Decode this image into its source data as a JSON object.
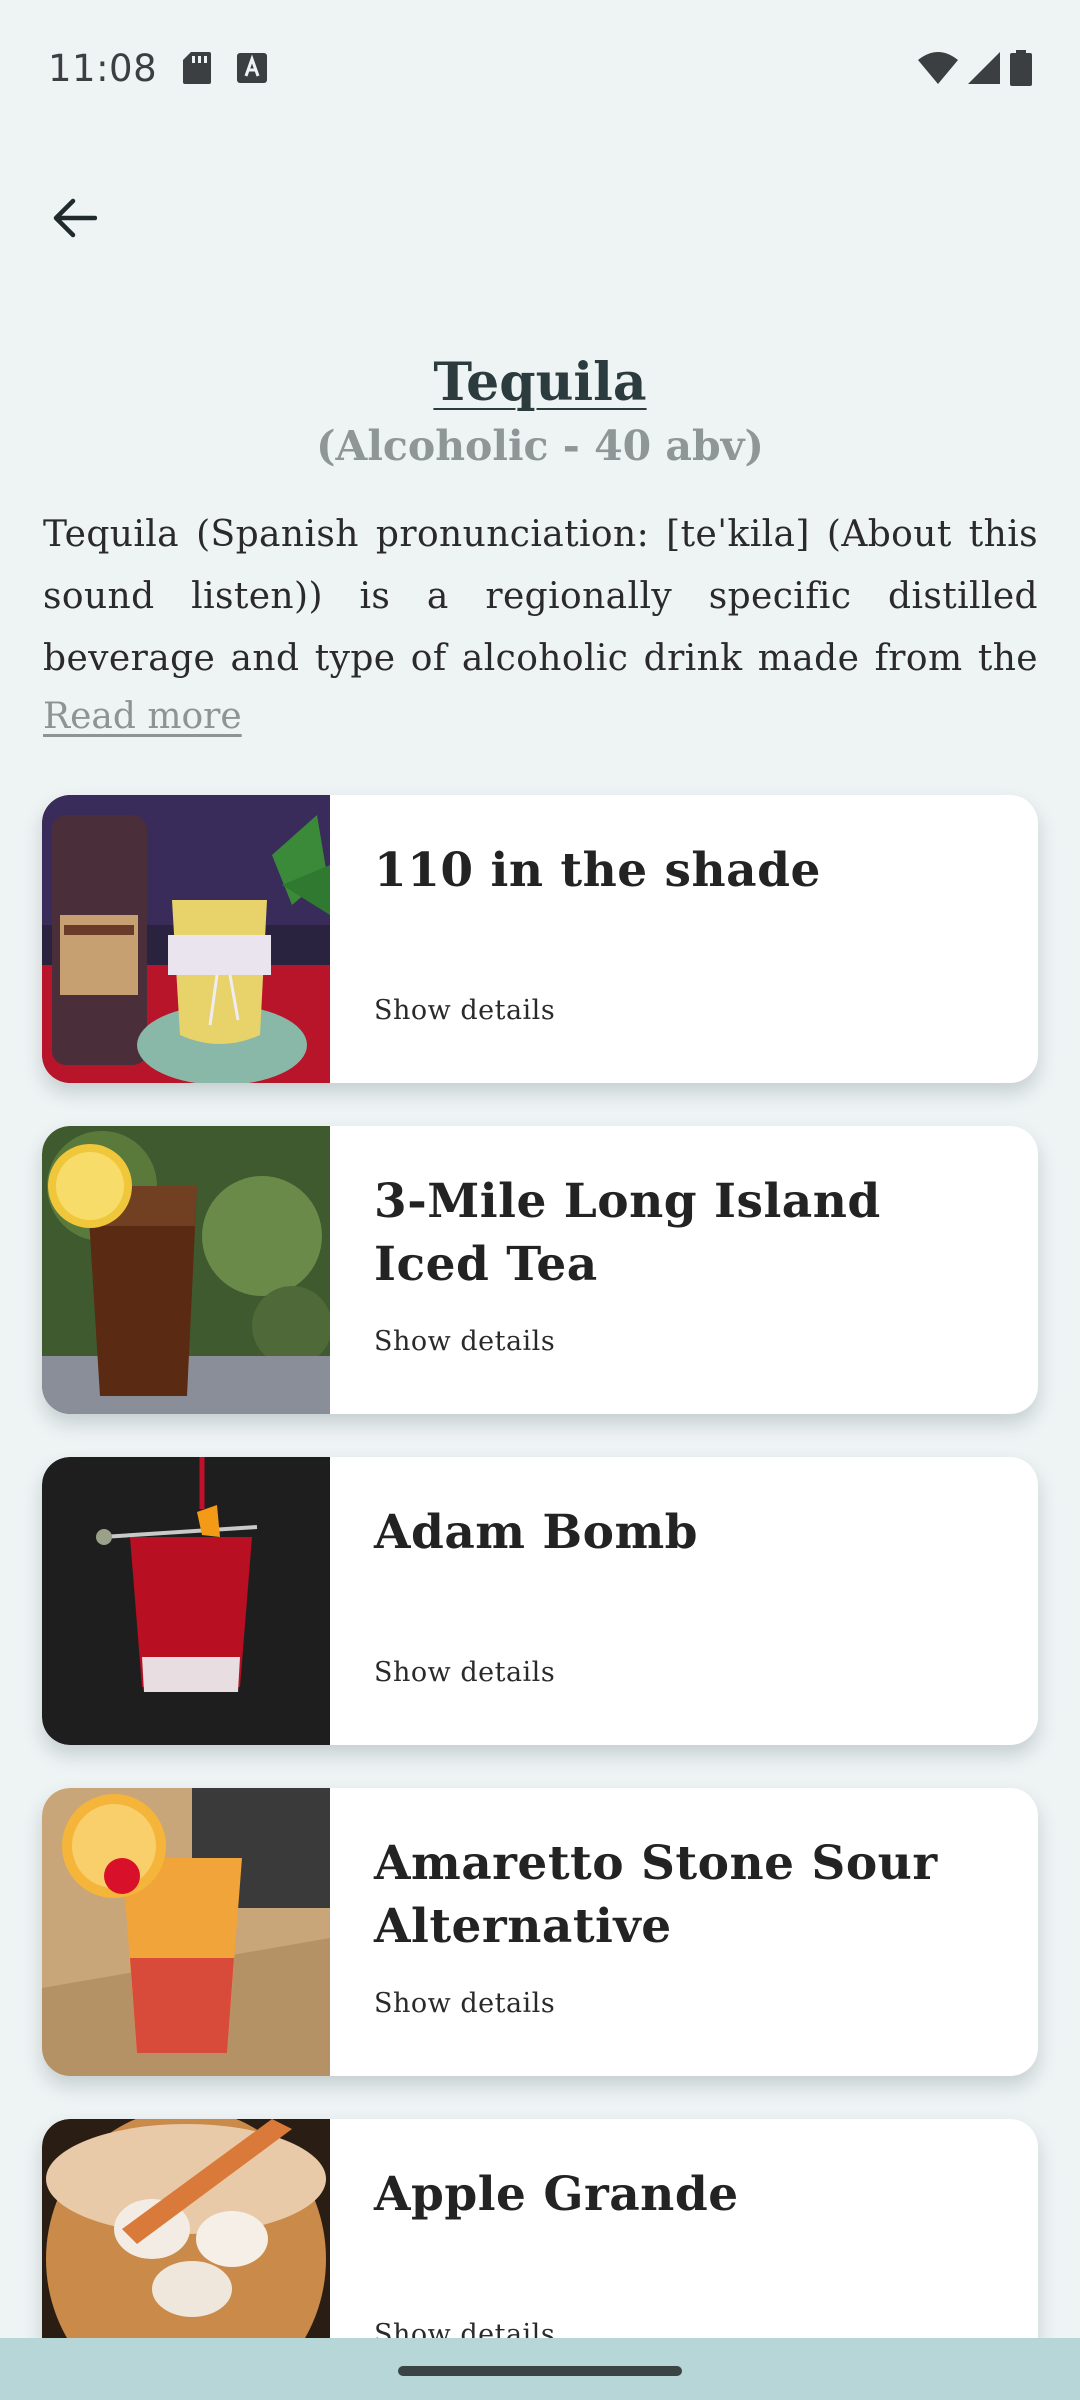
{
  "status_bar": {
    "time": "11:08",
    "icons": [
      "sd-card-icon",
      "text-a-icon",
      "wifi-icon",
      "cell-signal-icon",
      "battery-icon"
    ]
  },
  "header": {
    "back_icon": "arrow-back-icon",
    "title": "Tequila",
    "subtitle": "(Alcoholic - 40 abv)",
    "description": "Tequila (Spanish pronunciation: [teˈkila] (About this sound listen)) is a regionally specific distilled beverage and type of alcoholic drink made from the blue agave",
    "read_more": "Read more"
  },
  "drinks": [
    {
      "name": "110 in the shade",
      "details_label": "Show details",
      "image": "110-in-the-shade-photo"
    },
    {
      "name": "3-Mile Long Island Iced Tea",
      "details_label": "Show details",
      "image": "long-island-iced-tea-photo"
    },
    {
      "name": "Adam Bomb",
      "details_label": "Show details",
      "image": "adam-bomb-photo"
    },
    {
      "name": "Amaretto Stone Sour Alternative",
      "details_label": "Show details",
      "image": "amaretto-stone-sour-photo"
    },
    {
      "name": "Apple Grande",
      "details_label": "Show details",
      "image": "apple-grande-photo"
    }
  ],
  "colors": {
    "background": "#eef3f4",
    "card": "#ffffff",
    "title": "#2c3b3d",
    "muted": "#8f9696",
    "nav_bar": "#b6d6d7"
  }
}
